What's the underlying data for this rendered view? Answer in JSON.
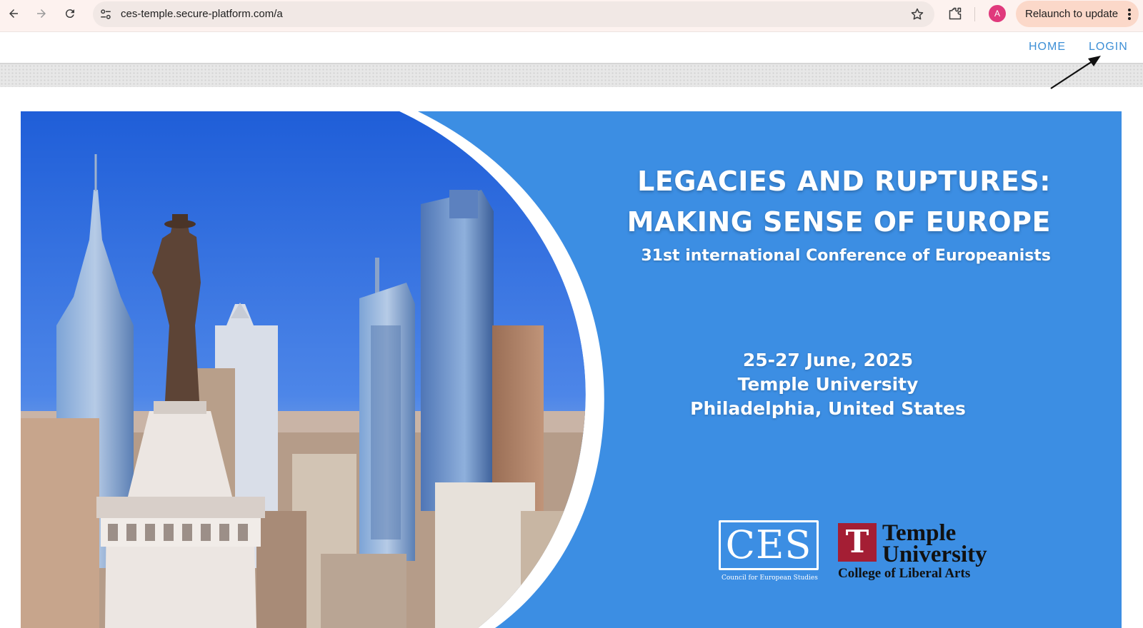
{
  "browser": {
    "url": "ces-temple.secure-platform.com/a",
    "profile_initial": "A",
    "relaunch_label": "Relaunch to update",
    "icons": [
      "back-arrow-icon",
      "forward-arrow-icon",
      "reload-icon",
      "site-settings-icon",
      "bookmark-star-icon",
      "extensions-puzzle-icon",
      "kebab-menu-icon"
    ]
  },
  "site_nav": {
    "home_label": "HOME",
    "login_label": "LOGIN",
    "link_color": "#3d8fd6"
  },
  "banner": {
    "headline_line1": "LEGACIES AND RUPTURES:",
    "headline_line2": "MAKING SENSE OF EUROPE",
    "subheading": "31st international Conference of Europeanists",
    "date": "25-27 June, 2025",
    "venue": "Temple University",
    "city": "Philadelphia, United States",
    "background_color": "#3c8ee3",
    "image_description_icon": "philadelphia-skyline-photo"
  },
  "logos": {
    "ces_mark": "CES",
    "ces_full_name": "Council for European Studies",
    "temple_mark": "T",
    "temple_name_line1": "Temple",
    "temple_name_line2": "University",
    "temple_college": "College of Liberal Arts",
    "temple_color": "#a41e34"
  }
}
